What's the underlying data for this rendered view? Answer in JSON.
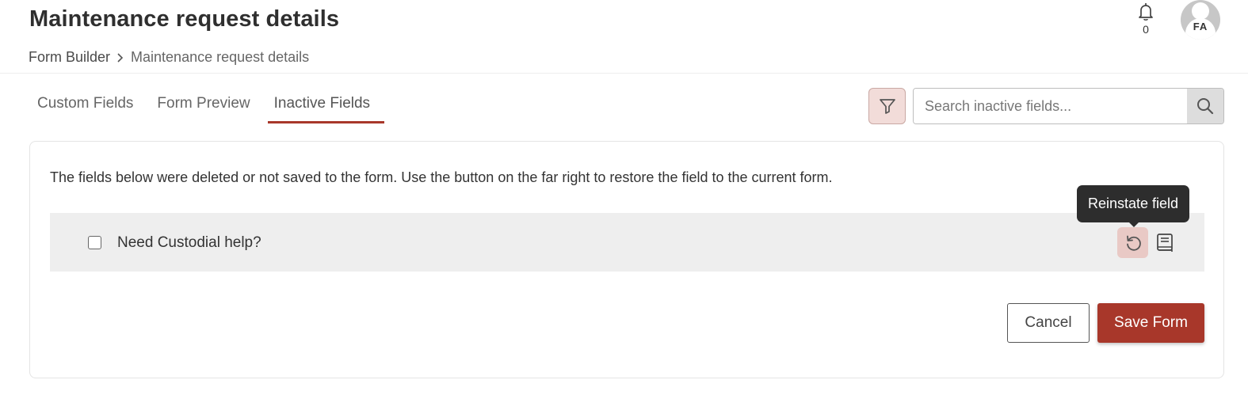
{
  "header": {
    "title": "Maintenance request details",
    "breadcrumb": {
      "root": "Form Builder",
      "current": "Maintenance request details"
    },
    "notifications": {
      "icon": "bell-icon",
      "count": "0"
    },
    "user": {
      "initials": "FA",
      "icon": "user-avatar-icon"
    }
  },
  "tabs": [
    {
      "label": "Custom Fields",
      "active": false
    },
    {
      "label": "Form Preview",
      "active": false
    },
    {
      "label": "Inactive Fields",
      "active": true
    }
  ],
  "toolbar": {
    "filter_icon": "filter-icon",
    "search_placeholder": "Search inactive fields...",
    "search_value": "",
    "search_icon": "search-icon"
  },
  "content": {
    "info_text": "The fields below were deleted or not saved to the form. Use the button on the far right to restore the field to the current form.",
    "fields": [
      {
        "label": "Need Custodial help?",
        "checked": false
      }
    ],
    "tooltip": "Reinstate field",
    "reinstate_icon": "restore-icon",
    "details_icon": "book-icon"
  },
  "actions": {
    "cancel_label": "Cancel",
    "save_label": "Save Form"
  },
  "colors": {
    "accent": "#a8372a",
    "accent_light": "#f2dcd9",
    "row_bg": "#eeeeee",
    "tooltip_bg": "#2d2d2d"
  }
}
